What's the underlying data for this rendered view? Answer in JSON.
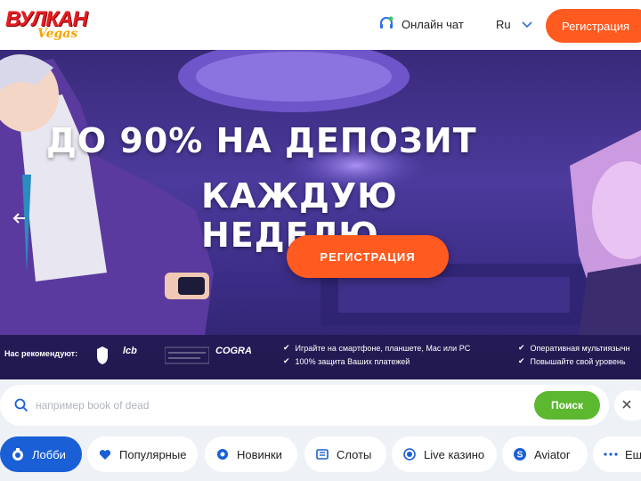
{
  "header": {
    "logo_main": "ВУЛКАН",
    "logo_sub": "Vegas",
    "chat_label": "Онлайн чат",
    "language": "Ru",
    "register_label": "Регистрация"
  },
  "banner": {
    "headline_line1": "ДО 90% НА ДЕПОЗИТ",
    "headline_line2": "КАЖДУЮ НЕДЕЛЮ",
    "cta_label": "РЕГИСТРАЦИЯ",
    "recommend_label": "Нас рекомендуют:",
    "partners": [
      "lcb",
      "COGRA"
    ],
    "features": [
      "Играйте на смартфоне, планшете, Mac или PC",
      "100% защита Ваших платежей",
      "Оперативная мультиязычн",
      "Повышайте свой уровень"
    ]
  },
  "search": {
    "placeholder": "например book of dead",
    "button_label": "Поиск"
  },
  "tabs": [
    {
      "label": "Лобби",
      "icon": "lobby-icon"
    },
    {
      "label": "Популярные",
      "icon": "heart-icon"
    },
    {
      "label": "Новинки",
      "icon": "new-icon"
    },
    {
      "label": "Слоты",
      "icon": "slots-icon"
    },
    {
      "label": "Live казино",
      "icon": "live-icon"
    },
    {
      "label": "Aviator",
      "icon": "aviator-icon"
    },
    {
      "label": "Ещ",
      "icon": "more-icon"
    }
  ],
  "colors": {
    "accent_orange": "#ff5a1f",
    "active_tab_blue": "#1a5fd6",
    "search_green": "#5cb82f"
  }
}
